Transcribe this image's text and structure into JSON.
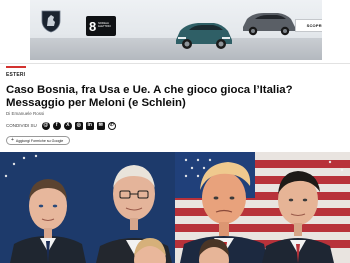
{
  "ad": {
    "brand_logo": "peugeot-lion-logo",
    "badge_number": "8",
    "badge_text": "Modelli elettrici",
    "cta_label": "SCOPRI DI PIÙ"
  },
  "article": {
    "section": "ESTERI",
    "headline": "Caso Bosnia, fra Usa e Ue. A che gioco gioca l’Italia? Messaggio per Meloni (e Schlein)",
    "author": "Di Emanuele Rossi",
    "share_label": "CONDIVIDI SU",
    "share_icons": [
      "threads-icon",
      "facebook-icon",
      "x-icon",
      "instagram-icon",
      "linkedin-icon",
      "email-icon",
      "whatsapp-icon"
    ],
    "share_glyphs": [
      "@",
      "f",
      "X",
      "◎",
      "in",
      "✉",
      "✆"
    ],
    "google_preference": {
      "plus": "+",
      "label": "Aggiungi Formiche su Google"
    }
  },
  "colors": {
    "accent_red": "#d3322f",
    "text_dark": "#0d0d0d",
    "muted": "#555555"
  }
}
